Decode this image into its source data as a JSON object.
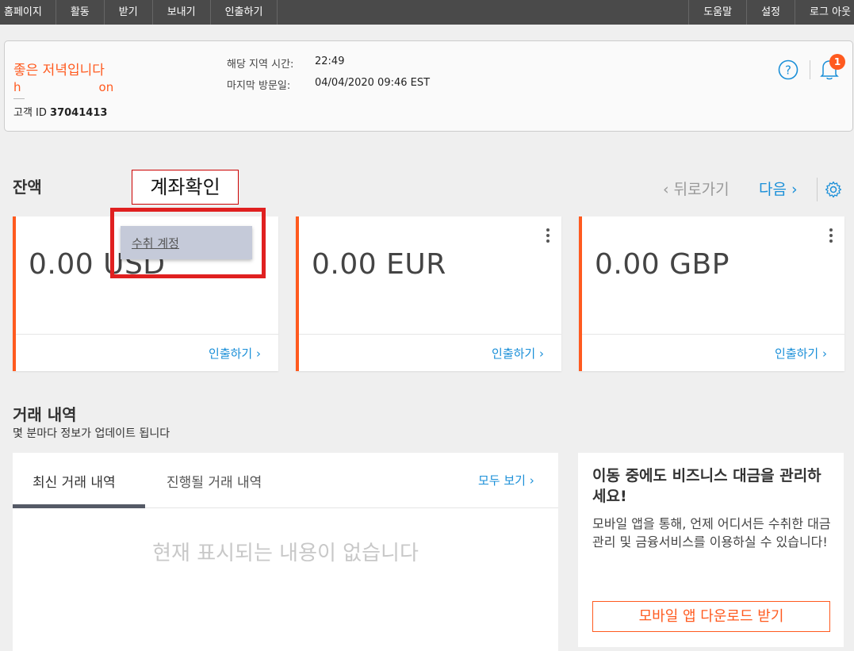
{
  "nav": {
    "left": [
      "홈페이지",
      "활동",
      "받기",
      "보내기",
      "인출하기"
    ],
    "right": [
      "도움말",
      "설정",
      "로그 아웃"
    ]
  },
  "welcome": {
    "greeting": "좋은 저녁입니다",
    "username_start": "h",
    "username_end": "on",
    "customer_id_label": "고객 ID",
    "customer_id": "37041413",
    "local_time_label": "해당 지역 시간:",
    "local_time": "22:49",
    "last_visit_label": "마지막 방문일:",
    "last_visit": "04/04/2020 09:46 EST",
    "notification_count": "1"
  },
  "balance": {
    "title": "잔액",
    "annotation": "계좌확인",
    "prev_label": "‹  뒤로가기",
    "next_label": "다음 ›",
    "dropdown_item": "수취 계정",
    "cards": [
      {
        "amount": "0.00 USD",
        "action": "인출하기 ›"
      },
      {
        "amount": "0.00 EUR",
        "action": "인출하기 ›"
      },
      {
        "amount": "0.00 GBP",
        "action": "인출하기 ›"
      }
    ]
  },
  "transactions": {
    "title": "거래 내역",
    "subtitle": "몇 분마다 정보가 업데이트 됩니다",
    "tab_recent": "최신 거래 내역",
    "tab_pending": "진행될 거래 내역",
    "view_all": "모두 보기 ›",
    "empty_message": "현재 표시되는 내용이 없습니다"
  },
  "promo": {
    "title": "이동 중에도 비즈니스 대금을 관리하세요!",
    "body": "모바일 앱을 통해, 언제 어디서든 수취한 대금관리 및 금융서비스를 이용하실 수 있습니다!",
    "button": "모바일 앱 다운로드 받기"
  },
  "colors": {
    "accent": "#ff5a1f",
    "link": "#1a8fd8",
    "nav_bg": "#4a4a4a",
    "highlight": "#e02020"
  }
}
